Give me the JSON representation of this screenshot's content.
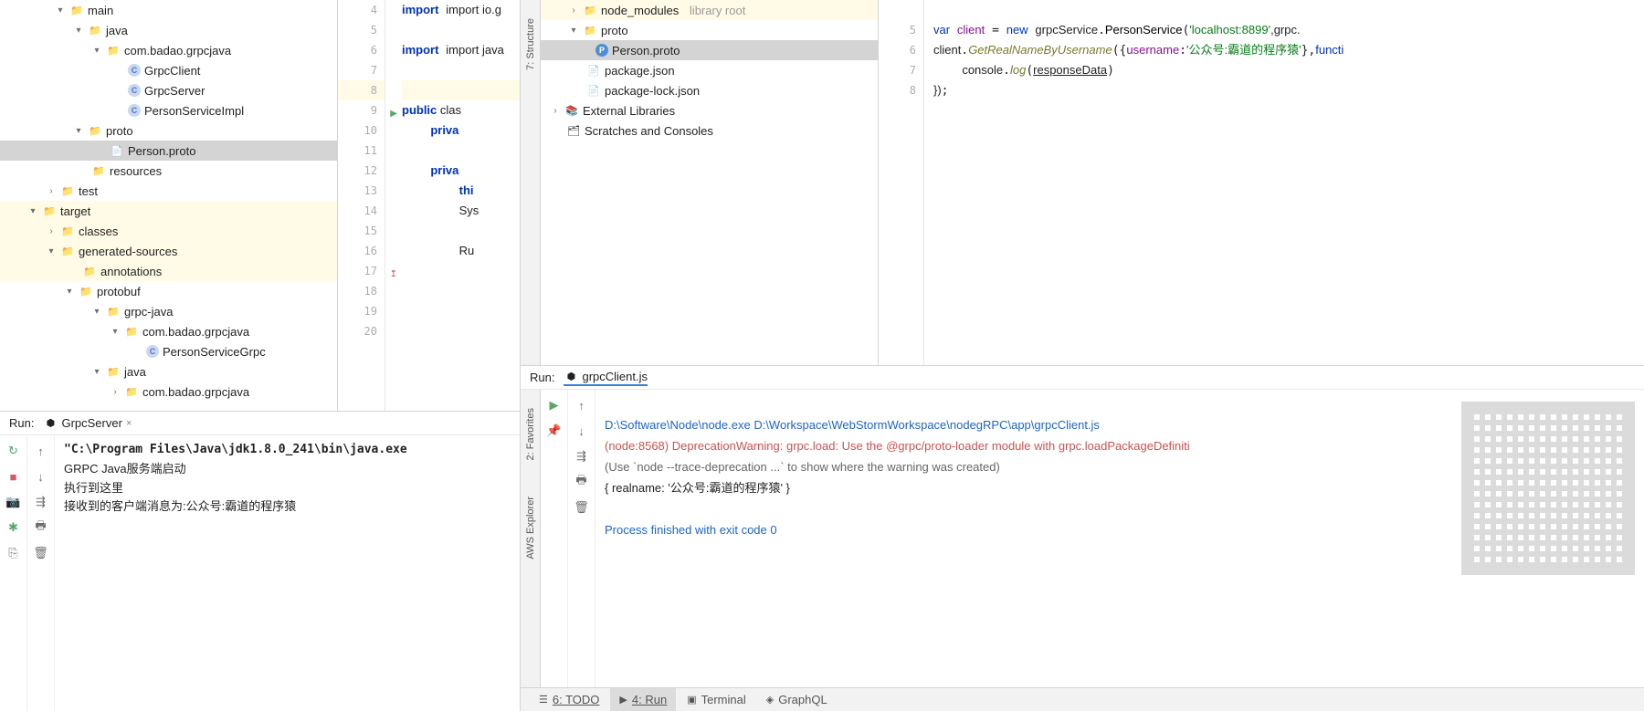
{
  "left_tree": {
    "main": "main",
    "java": "java",
    "pkg": "com.badao.grpcjava",
    "grpc_client": "GrpcClient",
    "grpc_server": "GrpcServer",
    "person_impl": "PersonServiceImpl",
    "proto": "proto",
    "person_proto": "Person.proto",
    "resources": "resources",
    "test": "test",
    "target": "target",
    "classes": "classes",
    "gensrc": "generated-sources",
    "annotations": "annotations",
    "protobuf": "protobuf",
    "grpc_java": "grpc-java",
    "pkg2": "com.badao.grpcjava",
    "psg": "PersonServiceGrpc",
    "java2": "java",
    "pkg3": "com.badao.grpcjava"
  },
  "left_code": {
    "l4": "import io.g",
    "l6": "import java",
    "l9a": "public",
    "l9b": " clas",
    "l10a": "priva",
    "l12a": "priva",
    "l13a": "thi",
    "l14a": "Sys",
    "l16a": "Ru"
  },
  "left_run": {
    "title": "Run:",
    "tab": "GrpcServer",
    "cmd": "\"C:\\Program Files\\Java\\jdk1.8.0_241\\bin\\java.exe",
    "line1": "GRPC Java服务端启动",
    "line2": "执行到这里",
    "line3": "接收到的客户端消息为:公众号:霸道的程序猿"
  },
  "right_tree": {
    "node_modules": "node_modules",
    "lib_root": "library root",
    "proto": "proto",
    "person_proto": "Person.proto",
    "pkg_json": "package.json",
    "pkg_lock": "package-lock.json",
    "ext_lib": "External Libraries",
    "scratch": "Scratches and Consoles"
  },
  "right_code": {
    "l5_var": "var",
    "l5_client": "client",
    "l5_new": "new",
    "l5_svc": "grpcService",
    "l5_ps": "PersonService",
    "l5_arg": "'localhost:8899'",
    "l5_tail": ",grpc.",
    "l6_cli": "client",
    "l6_m": "GetRealNameByUsername",
    "l6_user": "username",
    "l6_val": "'公众号:霸道的程序猿'",
    "l6_fn": "functi",
    "l7_con": "console",
    "l7_log": "log",
    "l7_rd": "responseData",
    "l8": "})"
  },
  "side": {
    "structure": "7: Structure",
    "favorites": "2: Favorites",
    "aws": "AWS Explorer"
  },
  "right_run": {
    "title": "Run:",
    "tab": "grpcClient.js",
    "l1": "D:\\Software\\Node\\node.exe D:\\Workspace\\WebStormWorkspace\\nodegRPC\\app\\grpcClient.js",
    "l2": "(node:8568) DeprecationWarning: grpc.load: Use the @grpc/proto-loader module with grpc.loadPackageDefiniti",
    "l3": "(Use `node --trace-deprecation ...` to show where the warning was created)",
    "l4": "{ realname: '公众号:霸道的程序猿' }",
    "l5": "Process finished with exit code 0"
  },
  "bottom": {
    "todo": "6: TODO",
    "run": "4: Run",
    "term": "Terminal",
    "gql": "GraphQL"
  }
}
